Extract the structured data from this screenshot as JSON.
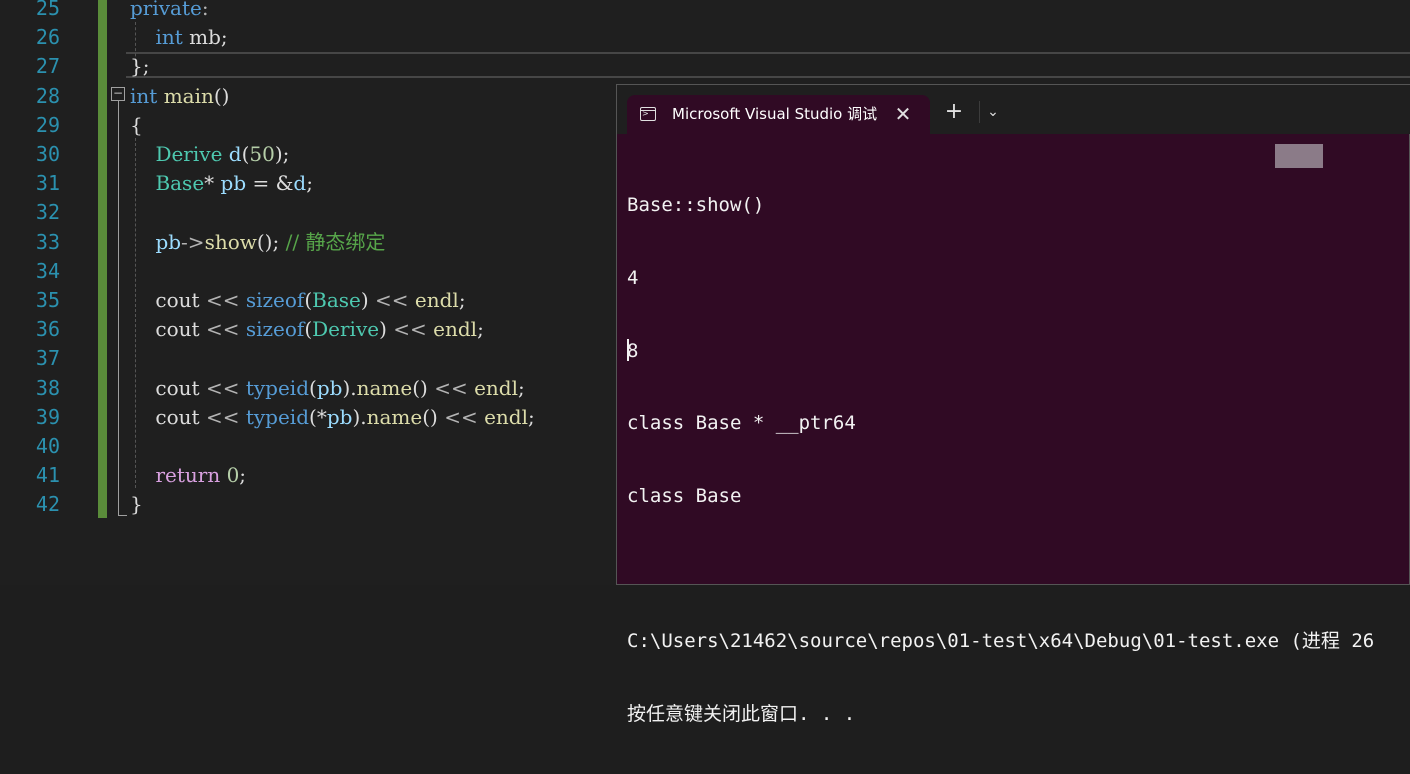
{
  "editor": {
    "lines": [
      {
        "n": "25",
        "tokens": [
          {
            "t": "private",
            "c": "kw"
          },
          {
            "t": ":",
            "c": "op"
          }
        ]
      },
      {
        "n": "26",
        "tokens": [
          {
            "t": "    ",
            "c": ""
          },
          {
            "t": "int",
            "c": "kw"
          },
          {
            "t": " mb;",
            "c": ""
          }
        ]
      },
      {
        "n": "27",
        "tokens": [
          {
            "t": "};",
            "c": ""
          }
        ]
      },
      {
        "n": "28",
        "tokens": [
          {
            "t": "int",
            "c": "kw"
          },
          {
            "t": " ",
            "c": ""
          },
          {
            "t": "main",
            "c": "fn"
          },
          {
            "t": "()",
            "c": ""
          }
        ]
      },
      {
        "n": "29",
        "tokens": [
          {
            "t": "{",
            "c": ""
          }
        ]
      },
      {
        "n": "30",
        "tokens": [
          {
            "t": "    ",
            "c": ""
          },
          {
            "t": "Derive",
            "c": "ty"
          },
          {
            "t": " ",
            "c": ""
          },
          {
            "t": "d",
            "c": "var"
          },
          {
            "t": "(",
            "c": ""
          },
          {
            "t": "50",
            "c": "num"
          },
          {
            "t": ");",
            "c": ""
          }
        ]
      },
      {
        "n": "31",
        "tokens": [
          {
            "t": "    ",
            "c": ""
          },
          {
            "t": "Base",
            "c": "ty"
          },
          {
            "t": "* ",
            "c": ""
          },
          {
            "t": "pb",
            "c": "var"
          },
          {
            "t": " = &",
            "c": ""
          },
          {
            "t": "d",
            "c": "var"
          },
          {
            "t": ";",
            "c": ""
          }
        ]
      },
      {
        "n": "32",
        "tokens": []
      },
      {
        "n": "33",
        "tokens": [
          {
            "t": "    ",
            "c": ""
          },
          {
            "t": "pb",
            "c": "var"
          },
          {
            "t": "->",
            "c": "op"
          },
          {
            "t": "show",
            "c": "fn"
          },
          {
            "t": "(); ",
            "c": ""
          },
          {
            "t": "// 静态绑定",
            "c": "cm"
          }
        ]
      },
      {
        "n": "34",
        "tokens": []
      },
      {
        "n": "35",
        "tokens": [
          {
            "t": "    cout ",
            "c": ""
          },
          {
            "t": "<<",
            "c": "op"
          },
          {
            "t": " ",
            "c": ""
          },
          {
            "t": "sizeof",
            "c": "kw"
          },
          {
            "t": "(",
            "c": ""
          },
          {
            "t": "Base",
            "c": "ty"
          },
          {
            "t": ") ",
            "c": ""
          },
          {
            "t": "<<",
            "c": "op"
          },
          {
            "t": " ",
            "c": ""
          },
          {
            "t": "endl",
            "c": "fn"
          },
          {
            "t": ";",
            "c": ""
          }
        ]
      },
      {
        "n": "36",
        "tokens": [
          {
            "t": "    cout ",
            "c": ""
          },
          {
            "t": "<<",
            "c": "op"
          },
          {
            "t": " ",
            "c": ""
          },
          {
            "t": "sizeof",
            "c": "kw"
          },
          {
            "t": "(",
            "c": ""
          },
          {
            "t": "Derive",
            "c": "ty"
          },
          {
            "t": ") ",
            "c": ""
          },
          {
            "t": "<<",
            "c": "op"
          },
          {
            "t": " ",
            "c": ""
          },
          {
            "t": "endl",
            "c": "fn"
          },
          {
            "t": ";",
            "c": ""
          }
        ]
      },
      {
        "n": "37",
        "tokens": []
      },
      {
        "n": "38",
        "tokens": [
          {
            "t": "    cout ",
            "c": ""
          },
          {
            "t": "<<",
            "c": "op"
          },
          {
            "t": " ",
            "c": ""
          },
          {
            "t": "typeid",
            "c": "kw"
          },
          {
            "t": "(",
            "c": ""
          },
          {
            "t": "pb",
            "c": "var"
          },
          {
            "t": ").",
            "c": ""
          },
          {
            "t": "name",
            "c": "fn"
          },
          {
            "t": "() ",
            "c": ""
          },
          {
            "t": "<<",
            "c": "op"
          },
          {
            "t": " ",
            "c": ""
          },
          {
            "t": "endl",
            "c": "fn"
          },
          {
            "t": ";",
            "c": ""
          }
        ]
      },
      {
        "n": "39",
        "tokens": [
          {
            "t": "    cout ",
            "c": ""
          },
          {
            "t": "<<",
            "c": "op"
          },
          {
            "t": " ",
            "c": ""
          },
          {
            "t": "typeid",
            "c": "kw"
          },
          {
            "t": "(*",
            "c": ""
          },
          {
            "t": "pb",
            "c": "var"
          },
          {
            "t": ").",
            "c": ""
          },
          {
            "t": "name",
            "c": "fn"
          },
          {
            "t": "() ",
            "c": ""
          },
          {
            "t": "<<",
            "c": "op"
          },
          {
            "t": " ",
            "c": ""
          },
          {
            "t": "endl",
            "c": "fn"
          },
          {
            "t": ";",
            "c": ""
          }
        ]
      },
      {
        "n": "40",
        "tokens": []
      },
      {
        "n": "41",
        "tokens": [
          {
            "t": "    ",
            "c": ""
          },
          {
            "t": "return",
            "c": "ctl"
          },
          {
            "t": " ",
            "c": ""
          },
          {
            "t": "0",
            "c": "num"
          },
          {
            "t": ";",
            "c": ""
          }
        ]
      },
      {
        "n": "42",
        "tokens": [
          {
            "t": "}",
            "c": ""
          }
        ]
      }
    ]
  },
  "terminal": {
    "tab_title": "Microsoft Visual Studio 调试控制台",
    "tab_close": "✕",
    "new_tab": "+",
    "dropdown": "⌄",
    "output": [
      "Base::show()",
      "4",
      "8",
      "class Base * __ptr64",
      "class Base",
      "",
      "C:\\Users\\21462\\source\\repos\\01-test\\x64\\Debug\\01-test.exe (进程 26",
      "按任意键关闭此窗口. . ."
    ]
  },
  "colors": {
    "terminal_bg": "#300a24",
    "editor_bg": "#1f1f1f",
    "line_number": "#2b91af",
    "change_bar": "#5a8c3a"
  }
}
